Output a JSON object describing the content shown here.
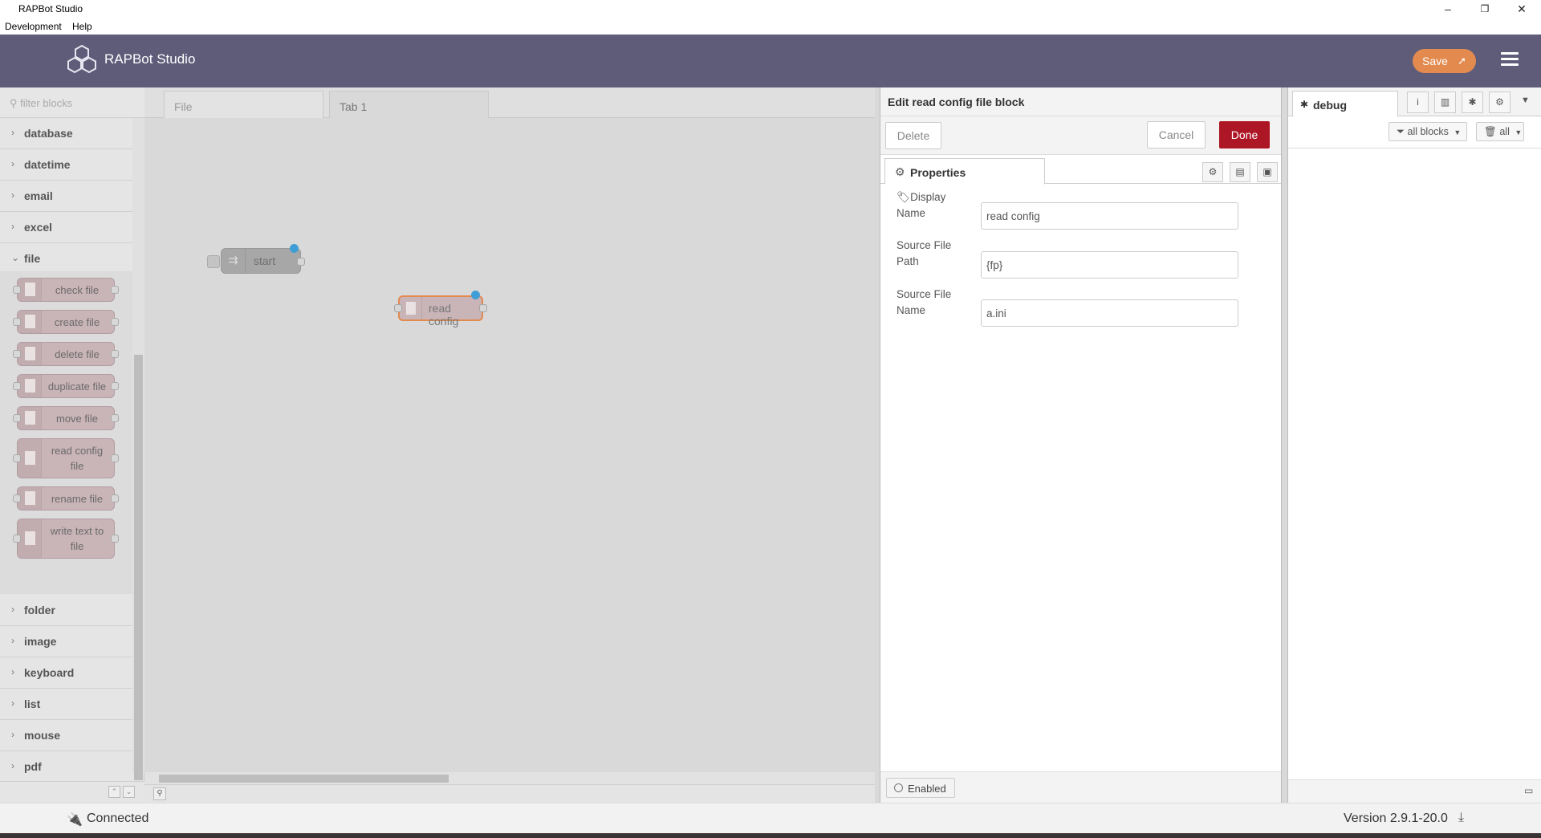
{
  "window": {
    "title": "RAPBot Studio",
    "minimize": "–",
    "maximize": "❐",
    "close": "✕"
  },
  "menu": {
    "items": [
      "Development",
      "Help"
    ]
  },
  "header": {
    "brand": "RAPBot Studio",
    "save_label": "Save",
    "accent": "#e38a4f",
    "bg": "#5f5c7a"
  },
  "palette": {
    "filter_placeholder": "filter blocks",
    "categories_top": [
      "database",
      "datetime",
      "email",
      "excel",
      "file"
    ],
    "file_items": [
      "check file",
      "create file",
      "delete file",
      "duplicate file",
      "move file",
      "read config file",
      "rename file",
      "write text to file"
    ],
    "categories_bottom": [
      "folder",
      "image",
      "keyboard",
      "list",
      "mouse",
      "pdf"
    ]
  },
  "workspace": {
    "tabs": [
      "File",
      "Tab 1"
    ],
    "active_tab": "Tab 1",
    "nodes": {
      "start": "start",
      "read_config": "read config"
    }
  },
  "editor": {
    "title": "Edit read config file block",
    "delete_label": "Delete",
    "cancel_label": "Cancel",
    "done_label": "Done",
    "tab_label": "Properties",
    "fields": [
      {
        "label_line1": "Display",
        "label_line2": "Name",
        "value": "read config"
      },
      {
        "label_line1": "Source File",
        "label_line2": "Path",
        "value": "{fp}"
      },
      {
        "label_line1": "Source File",
        "label_line2": "Name",
        "value": "a.ini"
      }
    ],
    "enabled_label": "Enabled"
  },
  "sidebar": {
    "tab_label": "debug",
    "filter_label": "all blocks",
    "clear_label": "all"
  },
  "status": {
    "connected": "Connected",
    "version": "Version 2.9.1-20.0"
  }
}
